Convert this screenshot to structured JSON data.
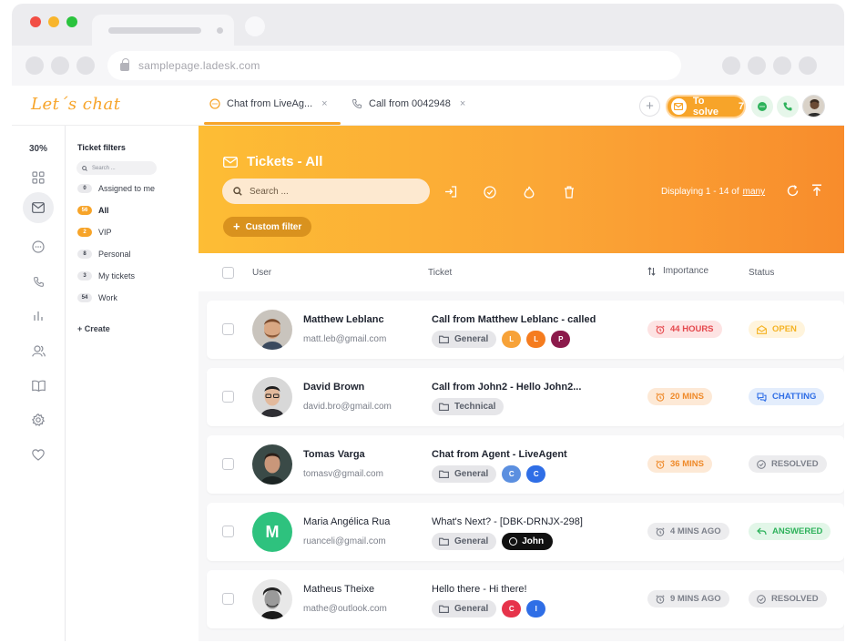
{
  "browser": {
    "url": "samplepage.ladesk.com",
    "traffic_lights": [
      "#f24e45",
      "#f8b52c",
      "#2ac33d"
    ]
  },
  "app": {
    "logo": "Let´s chat",
    "tabs": [
      {
        "label": "Chat from LiveAg...",
        "close": "×",
        "icon": "chat-bubble-icon"
      },
      {
        "label": "Call from 0042948",
        "close": "×",
        "icon": "phone-icon"
      }
    ],
    "add_label": "+",
    "to_solve": {
      "label": "To solve",
      "count": "7"
    }
  },
  "sidebar": {
    "percent": "30%",
    "filters_title": "Ticket filters",
    "search_placeholder": "Search ...",
    "items": [
      {
        "count": "0",
        "label": "Assigned to me",
        "active": false
      },
      {
        "count": "56",
        "label": "All",
        "active": true
      },
      {
        "count": "2",
        "label": "VIP",
        "active": false
      },
      {
        "count": "8",
        "label": "Personal",
        "active": false
      },
      {
        "count": "3",
        "label": "My tickets",
        "active": false
      },
      {
        "count": "54",
        "label": "Work",
        "active": false
      }
    ],
    "create_label": "+ Create"
  },
  "hero": {
    "title": "Tickets - All",
    "search_placeholder": "Search ...",
    "displaying_prefix": "Displaying 1 - 14 of",
    "displaying_link": "many",
    "custom_filter": "Custom filter"
  },
  "table": {
    "headers": {
      "user": "User",
      "ticket": "Ticket",
      "importance": "Importance",
      "status": "Status"
    },
    "rows": [
      {
        "name": "Matthew Leblanc",
        "email": "matt.leb@gmail.com",
        "subject": "Call from Matthew Leblanc - called",
        "department": "General",
        "tags": [
          {
            "letter": "L",
            "color": "#f7a238"
          },
          {
            "letter": "L",
            "color": "#f57c1f"
          },
          {
            "letter": "P",
            "color": "#8b1a4b"
          }
        ],
        "importance": "44 HOURS",
        "status": "OPEN"
      },
      {
        "name": "David Brown",
        "email": "david.bro@gmail.com",
        "subject": "Call from John2 - Hello John2...",
        "department": "Technical",
        "tags": [],
        "importance": "20 MINS",
        "status": "CHATTING"
      },
      {
        "name": "Tomas Varga",
        "email": "tomasv@gmail.com",
        "subject": "Chat from Agent - LiveAgent",
        "department": "General",
        "tags": [
          {
            "letter": "C",
            "color": "#5b8fe0"
          },
          {
            "letter": "C",
            "color": "#2f6ee6"
          }
        ],
        "importance": "36 MINS",
        "status": "RESOLVED"
      },
      {
        "name": "Maria Angélica Rua",
        "email": "ruanceli@gmail.com",
        "subject": "What's Next? - [DBK-DRNJX-298]",
        "department": "General",
        "agent": "John",
        "avatar_letter": "M",
        "importance": "4 MINS AGO",
        "status": "ANSWERED"
      },
      {
        "name": "Matheus Theixe",
        "email": "mathe@outlook.com",
        "subject": "Hello there - Hi there!",
        "department": "General",
        "tags": [
          {
            "letter": "C",
            "color": "#e6334a"
          },
          {
            "letter": "I",
            "color": "#2f6ee6"
          }
        ],
        "importance": "9 MINS AGO",
        "status": "RESOLVED"
      }
    ]
  },
  "colors": {
    "accent": "#f7a429",
    "open_bg": "#fff4dc",
    "open_fg": "#f5b324",
    "chatting_bg": "#e3edfc",
    "chatting_fg": "#2f6ee6",
    "resolved_bg": "#ececee",
    "resolved_fg": "#7d818b",
    "answered_bg": "#e2f6e8",
    "answered_fg": "#2eb25b",
    "imp_red_bg": "#fde3e3",
    "imp_red_fg": "#e5484d",
    "imp_orange_bg": "#fde9d6",
    "imp_orange_fg": "#ef8a2a",
    "imp_gray_bg": "#ececee",
    "imp_gray_fg": "#7d818b"
  }
}
